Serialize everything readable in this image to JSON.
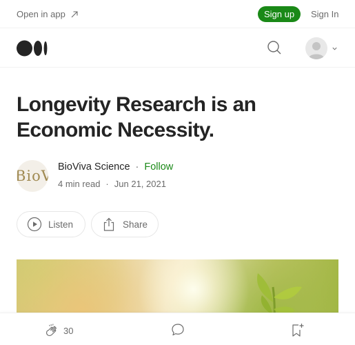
{
  "topbar": {
    "open_app_label": "Open in app",
    "signup_label": "Sign up",
    "signin_label": "Sign In"
  },
  "article": {
    "title": "Longevity Research is an Economic Necessity.",
    "author": {
      "name": "BioViva Science",
      "avatar_text": "BioV",
      "follow_label": "Follow",
      "separator": "·"
    },
    "meta": {
      "read_time": "4 min read",
      "separator": "·",
      "date": "Jun 21, 2021"
    },
    "actions": {
      "listen_label": "Listen",
      "share_label": "Share"
    }
  },
  "bottombar": {
    "clap_count": "30"
  },
  "colors": {
    "brand_green": "#1a8917",
    "text_primary": "#242424",
    "text_secondary": "#6b6b6b",
    "divider": "#f2f2f2"
  },
  "icons": {
    "open_app": "arrow-up-right-icon",
    "logo": "medium-logo-icon",
    "search": "search-icon",
    "avatar": "user-avatar-icon",
    "chevron": "chevron-down-icon",
    "listen": "play-circle-icon",
    "share": "share-icon",
    "clap": "clap-icon",
    "comment": "comment-icon",
    "bookmark": "bookmark-add-icon"
  }
}
